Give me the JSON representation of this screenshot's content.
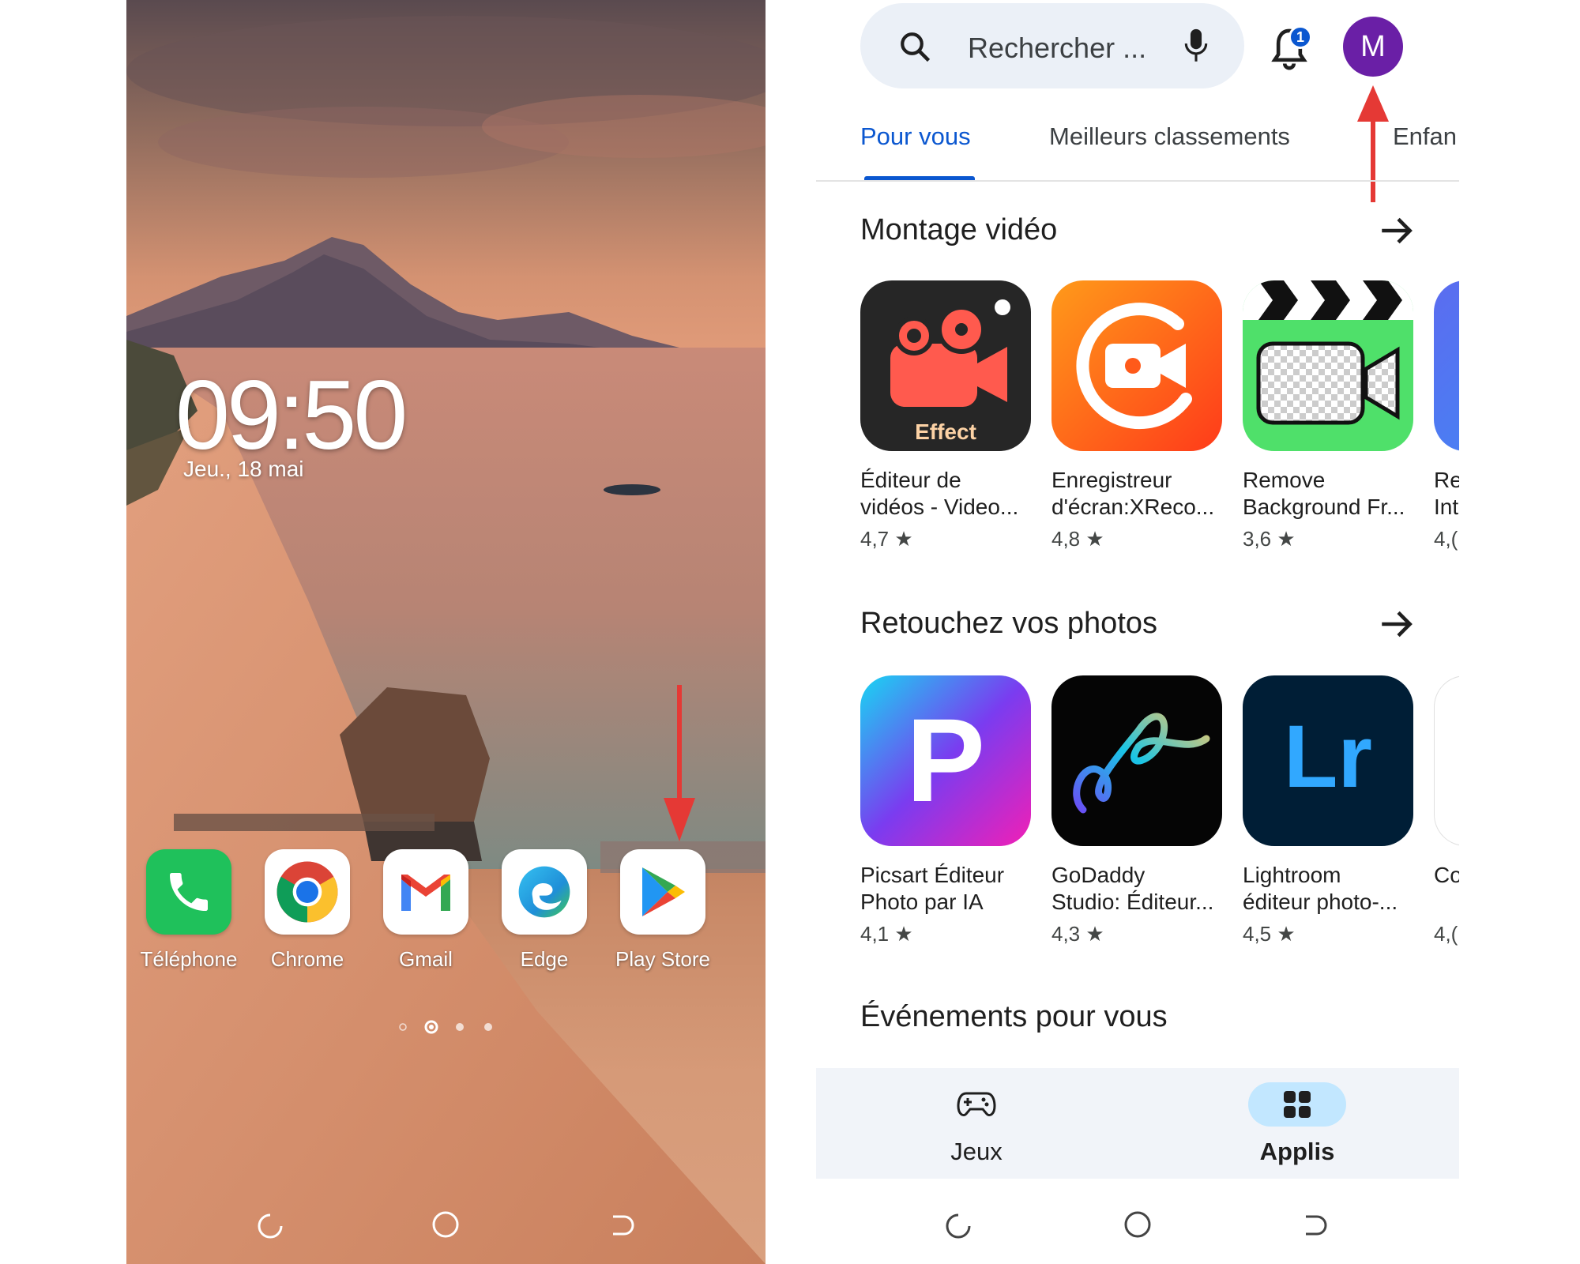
{
  "home_screen": {
    "clock": "09:50",
    "date": "Jeu., 18 mai",
    "dock_apps": [
      {
        "label": "Téléphone",
        "icon": "phone-icon"
      },
      {
        "label": "Chrome",
        "icon": "chrome-icon"
      },
      {
        "label": "Gmail",
        "icon": "gmail-icon"
      },
      {
        "label": "Edge",
        "icon": "edge-icon"
      },
      {
        "label": "Play Store",
        "icon": "play-store-icon"
      }
    ],
    "page_indicator": {
      "pages": 3,
      "current": 1
    },
    "annotation_color": "#e53935"
  },
  "play_store": {
    "search": {
      "placeholder": "Rechercher ..."
    },
    "notification_count": "1",
    "avatar_letter": "M",
    "tabs": [
      {
        "label": "Pour vous",
        "selected": true
      },
      {
        "label": "Meilleurs classements",
        "selected": false
      },
      {
        "label": "Enfan",
        "selected": false
      }
    ],
    "sections": [
      {
        "title": "Montage vidéo",
        "apps": [
          {
            "name": "Éditeur de\nvidéos - Video...",
            "rating": "4,7 ★",
            "badge": "Effect"
          },
          {
            "name": "Enregistreur\nd'écran:XReco...",
            "rating": "4,8 ★"
          },
          {
            "name": "Remove\nBackground Fr...",
            "rating": "3,6 ★"
          },
          {
            "name": "Re\nInt",
            "rating": "4,("
          }
        ]
      },
      {
        "title": "Retouchez vos photos",
        "apps": [
          {
            "name": "Picsart Éditeur\nPhoto par IA",
            "rating": "4,1 ★",
            "logo": "P"
          },
          {
            "name": "GoDaddy\nStudio: Éditeur...",
            "rating": "4,3 ★"
          },
          {
            "name": "Lightroom\néditeur photo-...",
            "rating": "4,5 ★",
            "logo": "Lr"
          },
          {
            "name": "Co",
            "rating": "4,("
          }
        ]
      },
      {
        "title": "Événements pour vous"
      }
    ],
    "bottom_nav": [
      {
        "label": "Jeux",
        "icon": "gamepad-icon",
        "selected": false
      },
      {
        "label": "Applis",
        "icon": "apps-grid-icon",
        "selected": true
      }
    ],
    "accent_color": "#0b57d0"
  }
}
